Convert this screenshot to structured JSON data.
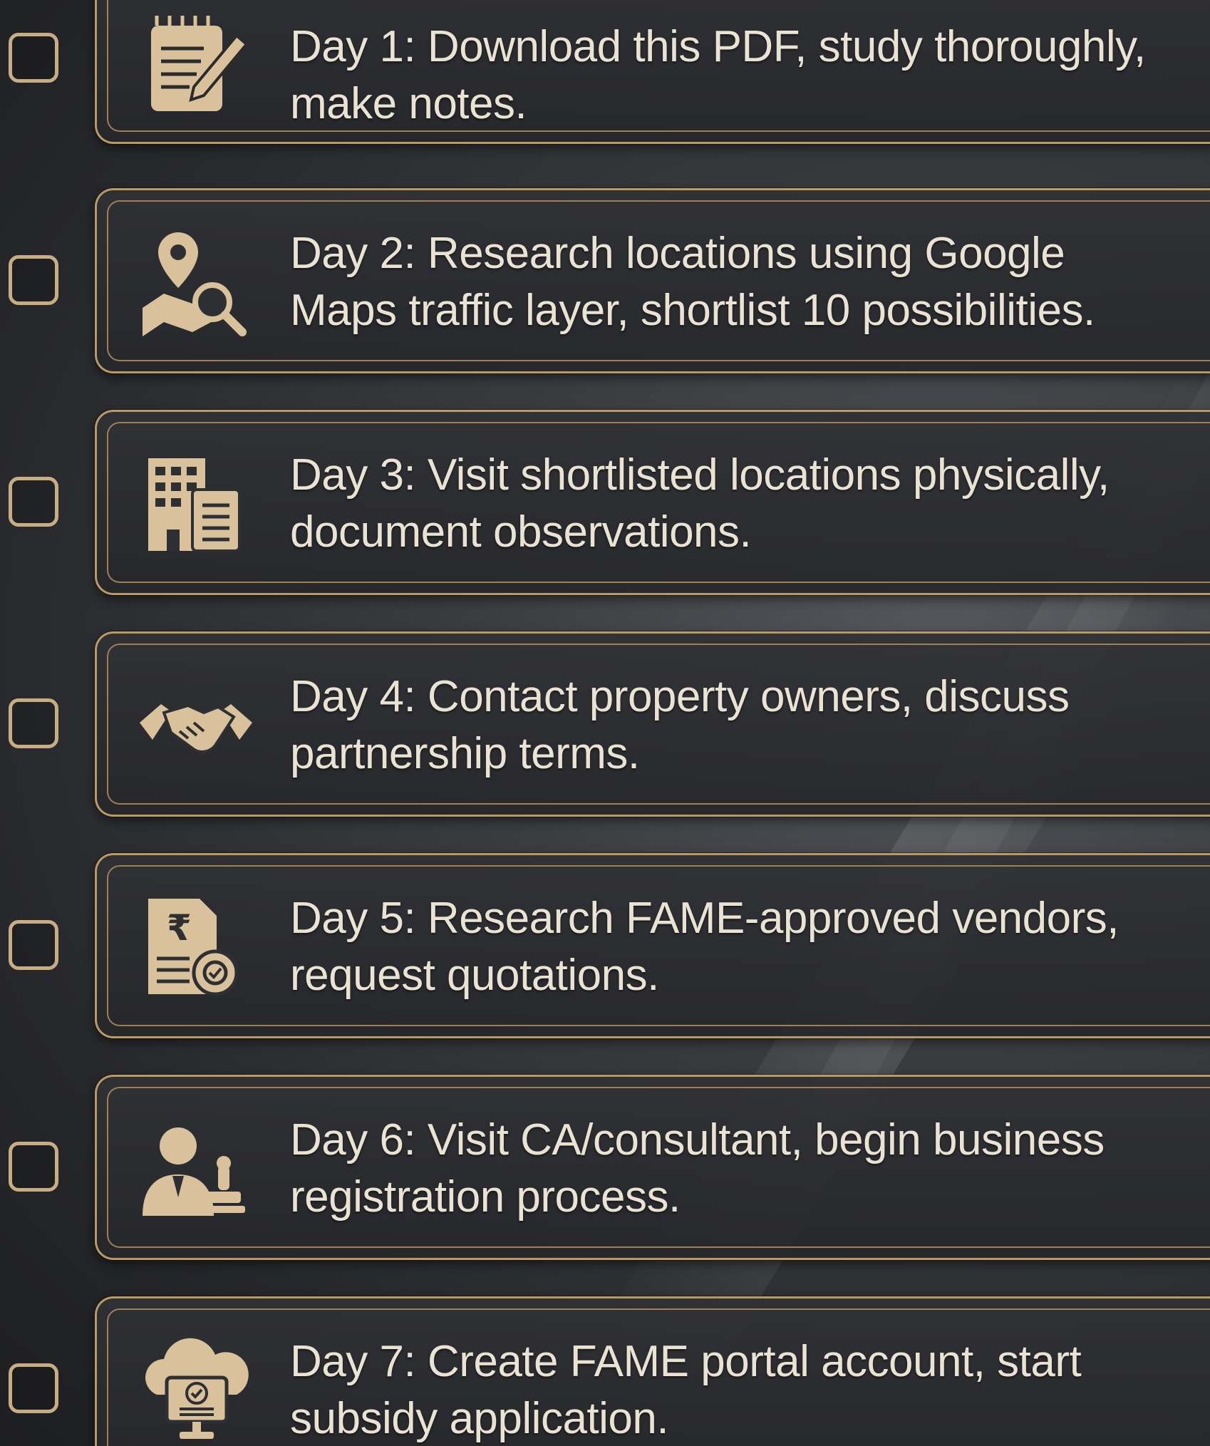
{
  "colors": {
    "gold": "#c7ad83",
    "text": "#eae2d3",
    "card": "#2e2f33",
    "background": "#2a2b2e"
  },
  "tasks": [
    {
      "lines": [
        "Day 1: Download this PDF, study thoroughly,",
        "make notes."
      ],
      "icon": "notepad-pencil-icon",
      "checked": false
    },
    {
      "lines": [
        "Day 2: Research locations using Google",
        "Maps traffic layer, shortlist 10 possibilities."
      ],
      "icon": "map-search-icon",
      "checked": false
    },
    {
      "lines": [
        "Day 3: Visit shortlisted locations physically,",
        "document observations."
      ],
      "icon": "building-document-icon",
      "checked": false
    },
    {
      "lines": [
        "Day 4: Contact property owners, discuss",
        "partnership terms."
      ],
      "icon": "handshake-icon",
      "checked": false
    },
    {
      "lines": [
        "Day 5: Research FAME-approved vendors,",
        "request quotations."
      ],
      "icon": "rupee-quotation-icon",
      "checked": false
    },
    {
      "lines": [
        "Day 6: Visit CA/consultant, begin business",
        "registration process."
      ],
      "icon": "consultant-stamp-icon",
      "checked": false
    },
    {
      "lines": [
        "Day 7: Create FAME portal account, start",
        "subsidy application."
      ],
      "icon": "cloud-computer-icon",
      "checked": false
    }
  ]
}
